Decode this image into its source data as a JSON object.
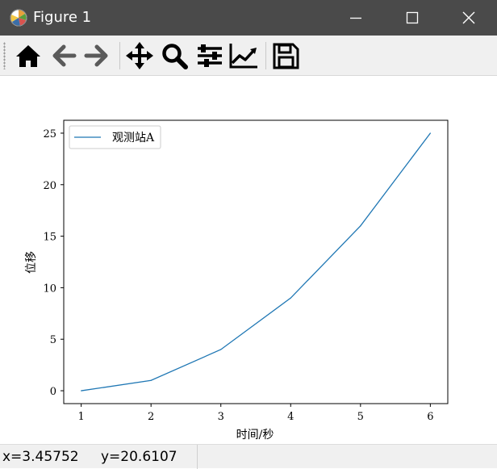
{
  "window": {
    "title": "Figure 1",
    "controls": [
      "minimize",
      "maximize",
      "close"
    ]
  },
  "toolbar": {
    "buttons": [
      {
        "id": "home",
        "icon": "home-icon",
        "tooltip": "Reset original view"
      },
      {
        "id": "back",
        "icon": "arrow-left-icon",
        "tooltip": "Back to previous view",
        "enabled": false
      },
      {
        "id": "forward",
        "icon": "arrow-right-icon",
        "tooltip": "Forward to next view",
        "enabled": false
      },
      {
        "id": "pan",
        "icon": "move-icon",
        "tooltip": "Pan axes"
      },
      {
        "id": "zoom",
        "icon": "zoom-icon",
        "tooltip": "Zoom to rectangle"
      },
      {
        "id": "subplots",
        "icon": "sliders-icon",
        "tooltip": "Configure subplots"
      },
      {
        "id": "customize",
        "icon": "line-chart-icon",
        "tooltip": "Edit axis, curve and image parameters"
      },
      {
        "id": "save",
        "icon": "save-icon",
        "tooltip": "Save the figure"
      }
    ]
  },
  "status": {
    "x_text": "x=3.45752",
    "y_text": "y=20.6107"
  },
  "chart_data": {
    "type": "line",
    "title": "",
    "xlabel": "时间/秒",
    "ylabel": "位移",
    "x": [
      1,
      2,
      3,
      4,
      5,
      6
    ],
    "series": [
      {
        "name": "观测站A",
        "values": [
          0,
          1,
          4,
          9,
          16,
          25
        ],
        "color": "#1f77b4"
      }
    ],
    "xlim": [
      0.75,
      6.25
    ],
    "ylim": [
      -1.25,
      26.25
    ],
    "xticks": [
      1,
      2,
      3,
      4,
      5,
      6
    ],
    "yticks": [
      0,
      5,
      10,
      15,
      20,
      25
    ],
    "grid": false,
    "legend_position": "top-left"
  }
}
